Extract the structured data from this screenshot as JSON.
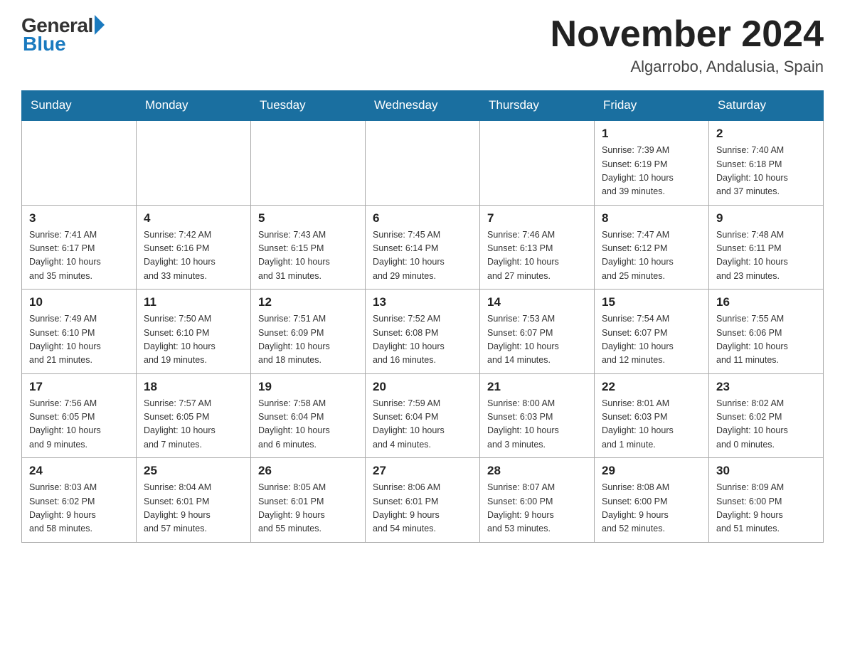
{
  "header": {
    "logo_general": "General",
    "logo_blue": "Blue",
    "month_title": "November 2024",
    "location": "Algarrobo, Andalusia, Spain"
  },
  "days_of_week": [
    "Sunday",
    "Monday",
    "Tuesday",
    "Wednesday",
    "Thursday",
    "Friday",
    "Saturday"
  ],
  "weeks": [
    [
      {
        "day": "",
        "info": "",
        "empty": true
      },
      {
        "day": "",
        "info": "",
        "empty": true
      },
      {
        "day": "",
        "info": "",
        "empty": true
      },
      {
        "day": "",
        "info": "",
        "empty": true
      },
      {
        "day": "",
        "info": "",
        "empty": true
      },
      {
        "day": "1",
        "info": "Sunrise: 7:39 AM\nSunset: 6:19 PM\nDaylight: 10 hours\nand 39 minutes."
      },
      {
        "day": "2",
        "info": "Sunrise: 7:40 AM\nSunset: 6:18 PM\nDaylight: 10 hours\nand 37 minutes."
      }
    ],
    [
      {
        "day": "3",
        "info": "Sunrise: 7:41 AM\nSunset: 6:17 PM\nDaylight: 10 hours\nand 35 minutes."
      },
      {
        "day": "4",
        "info": "Sunrise: 7:42 AM\nSunset: 6:16 PM\nDaylight: 10 hours\nand 33 minutes."
      },
      {
        "day": "5",
        "info": "Sunrise: 7:43 AM\nSunset: 6:15 PM\nDaylight: 10 hours\nand 31 minutes."
      },
      {
        "day": "6",
        "info": "Sunrise: 7:45 AM\nSunset: 6:14 PM\nDaylight: 10 hours\nand 29 minutes."
      },
      {
        "day": "7",
        "info": "Sunrise: 7:46 AM\nSunset: 6:13 PM\nDaylight: 10 hours\nand 27 minutes."
      },
      {
        "day": "8",
        "info": "Sunrise: 7:47 AM\nSunset: 6:12 PM\nDaylight: 10 hours\nand 25 minutes."
      },
      {
        "day": "9",
        "info": "Sunrise: 7:48 AM\nSunset: 6:11 PM\nDaylight: 10 hours\nand 23 minutes."
      }
    ],
    [
      {
        "day": "10",
        "info": "Sunrise: 7:49 AM\nSunset: 6:10 PM\nDaylight: 10 hours\nand 21 minutes."
      },
      {
        "day": "11",
        "info": "Sunrise: 7:50 AM\nSunset: 6:10 PM\nDaylight: 10 hours\nand 19 minutes."
      },
      {
        "day": "12",
        "info": "Sunrise: 7:51 AM\nSunset: 6:09 PM\nDaylight: 10 hours\nand 18 minutes."
      },
      {
        "day": "13",
        "info": "Sunrise: 7:52 AM\nSunset: 6:08 PM\nDaylight: 10 hours\nand 16 minutes."
      },
      {
        "day": "14",
        "info": "Sunrise: 7:53 AM\nSunset: 6:07 PM\nDaylight: 10 hours\nand 14 minutes."
      },
      {
        "day": "15",
        "info": "Sunrise: 7:54 AM\nSunset: 6:07 PM\nDaylight: 10 hours\nand 12 minutes."
      },
      {
        "day": "16",
        "info": "Sunrise: 7:55 AM\nSunset: 6:06 PM\nDaylight: 10 hours\nand 11 minutes."
      }
    ],
    [
      {
        "day": "17",
        "info": "Sunrise: 7:56 AM\nSunset: 6:05 PM\nDaylight: 10 hours\nand 9 minutes."
      },
      {
        "day": "18",
        "info": "Sunrise: 7:57 AM\nSunset: 6:05 PM\nDaylight: 10 hours\nand 7 minutes."
      },
      {
        "day": "19",
        "info": "Sunrise: 7:58 AM\nSunset: 6:04 PM\nDaylight: 10 hours\nand 6 minutes."
      },
      {
        "day": "20",
        "info": "Sunrise: 7:59 AM\nSunset: 6:04 PM\nDaylight: 10 hours\nand 4 minutes."
      },
      {
        "day": "21",
        "info": "Sunrise: 8:00 AM\nSunset: 6:03 PM\nDaylight: 10 hours\nand 3 minutes."
      },
      {
        "day": "22",
        "info": "Sunrise: 8:01 AM\nSunset: 6:03 PM\nDaylight: 10 hours\nand 1 minute."
      },
      {
        "day": "23",
        "info": "Sunrise: 8:02 AM\nSunset: 6:02 PM\nDaylight: 10 hours\nand 0 minutes."
      }
    ],
    [
      {
        "day": "24",
        "info": "Sunrise: 8:03 AM\nSunset: 6:02 PM\nDaylight: 9 hours\nand 58 minutes."
      },
      {
        "day": "25",
        "info": "Sunrise: 8:04 AM\nSunset: 6:01 PM\nDaylight: 9 hours\nand 57 minutes."
      },
      {
        "day": "26",
        "info": "Sunrise: 8:05 AM\nSunset: 6:01 PM\nDaylight: 9 hours\nand 55 minutes."
      },
      {
        "day": "27",
        "info": "Sunrise: 8:06 AM\nSunset: 6:01 PM\nDaylight: 9 hours\nand 54 minutes."
      },
      {
        "day": "28",
        "info": "Sunrise: 8:07 AM\nSunset: 6:00 PM\nDaylight: 9 hours\nand 53 minutes."
      },
      {
        "day": "29",
        "info": "Sunrise: 8:08 AM\nSunset: 6:00 PM\nDaylight: 9 hours\nand 52 minutes."
      },
      {
        "day": "30",
        "info": "Sunrise: 8:09 AM\nSunset: 6:00 PM\nDaylight: 9 hours\nand 51 minutes."
      }
    ]
  ]
}
